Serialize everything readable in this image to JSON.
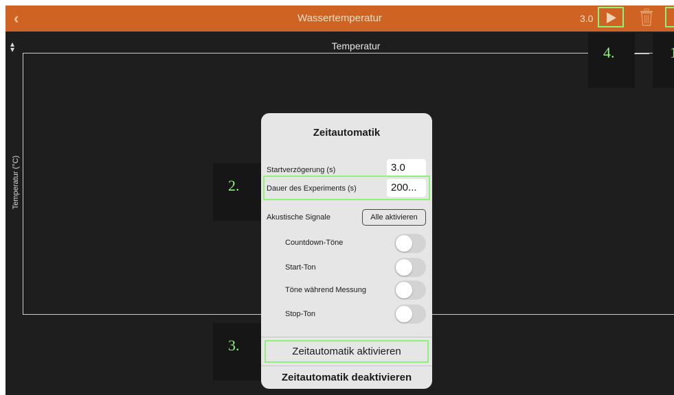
{
  "navbar": {
    "back_icon": "chevron-left-icon",
    "back_glyph": "‹",
    "title": "Wassertemperatur",
    "start_delay": "3.0",
    "play_icon": "play-icon",
    "trash_icon": "trash-icon"
  },
  "plot": {
    "title": "Temperatur",
    "y_label": "Temperatur (°C)",
    "sort_icon": "sort-arrows-icon"
  },
  "callouts": {
    "one": "1",
    "two": "2.",
    "three": "3.",
    "four": "4."
  },
  "panel": {
    "title": "Zeitautomatik",
    "start_delay_label": "Startverzögerung (s)",
    "start_delay_value": "3.0",
    "duration_label": "Dauer des Experiments (s)",
    "duration_value": "200...",
    "acoustic_label": "Akustische Signale",
    "all_activate_label": "Alle aktivieren",
    "toggles": [
      {
        "label": "Countdown-Töne",
        "on": false
      },
      {
        "label": "Start-Ton",
        "on": false
      },
      {
        "label": "Töne während Messung",
        "on": false
      },
      {
        "label": "Stop-Ton",
        "on": false
      }
    ],
    "activate_label": "Zeitautomatik aktivieren",
    "deactivate_label": "Zeitautomatik deaktivieren"
  },
  "colors": {
    "navbar": "#cf6323",
    "background": "#1e1e1e",
    "highlight": "#8ef27a",
    "panel": "#e6e6e6"
  }
}
